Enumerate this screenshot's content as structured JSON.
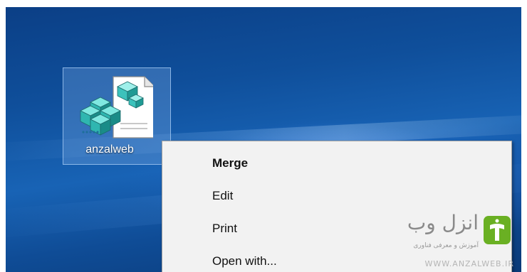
{
  "desktop": {
    "icon": {
      "label": "anzalweb",
      "icon_name": "registry-file-icon"
    }
  },
  "context_menu": {
    "items": [
      {
        "label": "Merge",
        "default": true
      },
      {
        "label": "Edit",
        "default": false
      },
      {
        "label": "Print",
        "default": false
      },
      {
        "label": "Open with...",
        "default": false
      }
    ]
  },
  "watermark": {
    "title": "انزل وب",
    "subtitle": "آموزش و معرفی فناوری",
    "url": "WWW.ANZALWEB.IR"
  },
  "colors": {
    "desktop_background": "#0f4f9b",
    "selection_fill": "#6ea0dc",
    "menu_background": "#f2f2f2",
    "logo_accent": "#6ab023"
  }
}
